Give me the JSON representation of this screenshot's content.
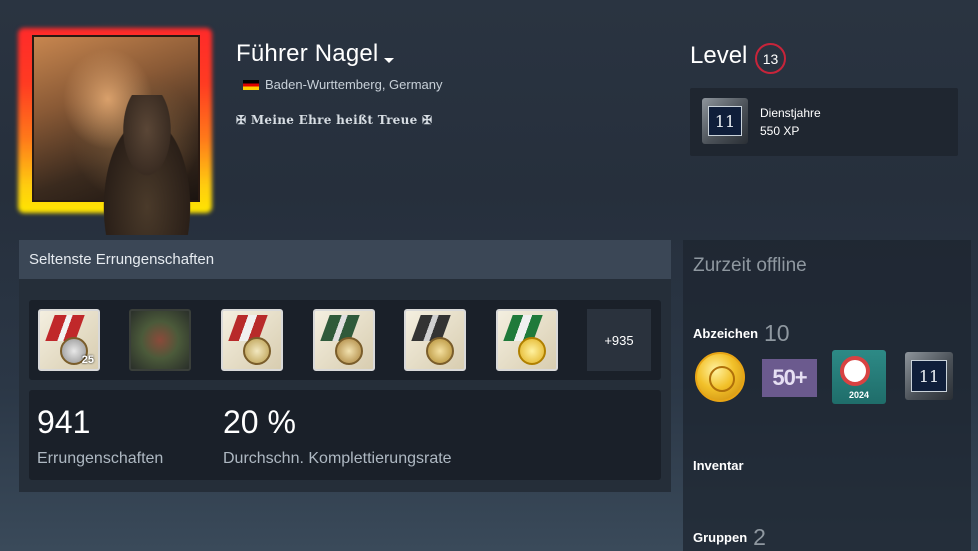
{
  "profile": {
    "name": "Führer Nagel",
    "location": "Baden-Wurttemberg, Germany",
    "motto": "✠ Meine Ehre heißt Treue ✠"
  },
  "level": {
    "label": "Level",
    "value": "13"
  },
  "featured_badge": {
    "name": "Dienstjahre",
    "xp": "550 XP",
    "years": "11"
  },
  "achievements": {
    "header": "Seltenste Errungenschaften",
    "icons": [
      {
        "name": "medal-icon",
        "level": "25"
      },
      {
        "name": "tank-crest-icon"
      },
      {
        "name": "medal-icon"
      },
      {
        "name": "medal-icon"
      },
      {
        "name": "medal-icon"
      },
      {
        "name": "gold-star-medal-icon"
      }
    ],
    "more": "+935",
    "count_value": "941",
    "count_label": "Errungenschaften",
    "rate_value": "20 %",
    "rate_label": "Durchschn. Komplettierungsrate"
  },
  "sidebar": {
    "status": "Zurzeit offline",
    "badges_label": "Abzeichen",
    "badges_count": "10",
    "badge_50": "50+",
    "badge_year": "2024",
    "badge_years": "11",
    "inventory_label": "Inventar",
    "groups_label": "Gruppen",
    "groups_count": "2"
  },
  "colors": {
    "level_ring": "#c7243a",
    "panel_header": "#3b4756",
    "panel_bg": "#1a2029"
  }
}
